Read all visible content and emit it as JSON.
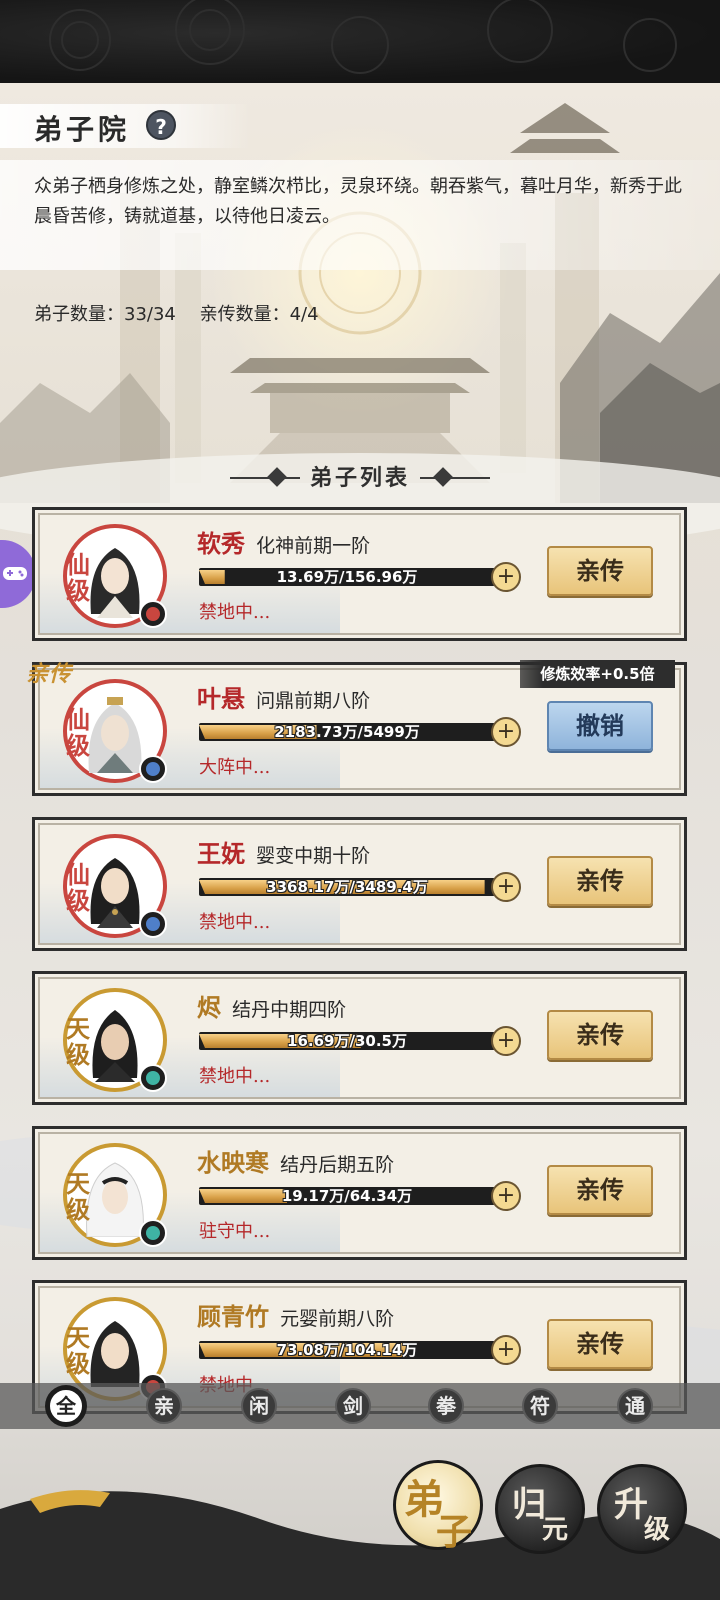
{
  "page": {
    "title": "弟子院",
    "help": "?",
    "intro": "众弟子栖身修炼之处，静室鳞次栉比，灵泉环绕。朝吞紫气，暮吐月华，新秀于此晨昏苦修，铸就道基，以待他日凌云。",
    "disciple_count": "弟子数量：33/34",
    "inner_count": "亲传数量：4/4",
    "list_title": "弟子列表"
  },
  "inner_tag": "亲传",
  "bonus_badge": "修炼效率+0.5倍",
  "disciples": [
    {
      "name": "软秀",
      "realm": "化神前期一阶",
      "progress_text": "13.69万/156.96万",
      "progress": 0.087,
      "status": "禁地中...",
      "grade": "仙级",
      "action": "亲传",
      "element_color": "#c9463f",
      "tier": "xian"
    },
    {
      "name": "叶悬",
      "realm": "问鼎前期八阶",
      "progress_text": "2183.73万/5499万",
      "progress": 0.397,
      "status": "大阵中...",
      "grade": "仙级",
      "action": "撤销",
      "element_color": "#4f7fc9",
      "tier": "xian"
    },
    {
      "name": "王妩",
      "realm": "婴变中期十阶",
      "progress_text": "3368.17万/3489.4万",
      "progress": 0.965,
      "status": "禁地中...",
      "grade": "仙级",
      "action": "亲传",
      "element_color": "#4f7fc9",
      "tier": "xian"
    },
    {
      "name": "烬",
      "realm": "结丹中期四阶",
      "progress_text": "16.69万/30.5万",
      "progress": 0.547,
      "status": "禁地中...",
      "grade": "天级",
      "action": "亲传",
      "element_color": "#3fb3a4",
      "tier": "tian"
    },
    {
      "name": "水映寒",
      "realm": "结丹后期五阶",
      "progress_text": "19.17万/64.34万",
      "progress": 0.298,
      "status": "驻守中...",
      "grade": "天级",
      "action": "亲传",
      "element_color": "#3fb3a4",
      "tier": "tian"
    },
    {
      "name": "顾青竹",
      "realm": "元婴前期八阶",
      "progress_text": "73.08万/104.14万",
      "progress": 0.702,
      "status": "禁地中...",
      "grade": "天级",
      "action": "亲传",
      "element_color": "#c9463f",
      "tier": "tian"
    }
  ],
  "filters": [
    "全",
    "亲",
    "闲",
    "剑",
    "拳",
    "符",
    "通"
  ],
  "active_filter": "全",
  "nav": [
    {
      "a": "弟",
      "b": "子",
      "active": true
    },
    {
      "a": "归",
      "b": "元",
      "active": false
    },
    {
      "a": "升",
      "b": "级",
      "active": false
    }
  ],
  "icons": {
    "help": "question-icon",
    "assist": "gamepad-icon",
    "plus": "plus-icon"
  }
}
